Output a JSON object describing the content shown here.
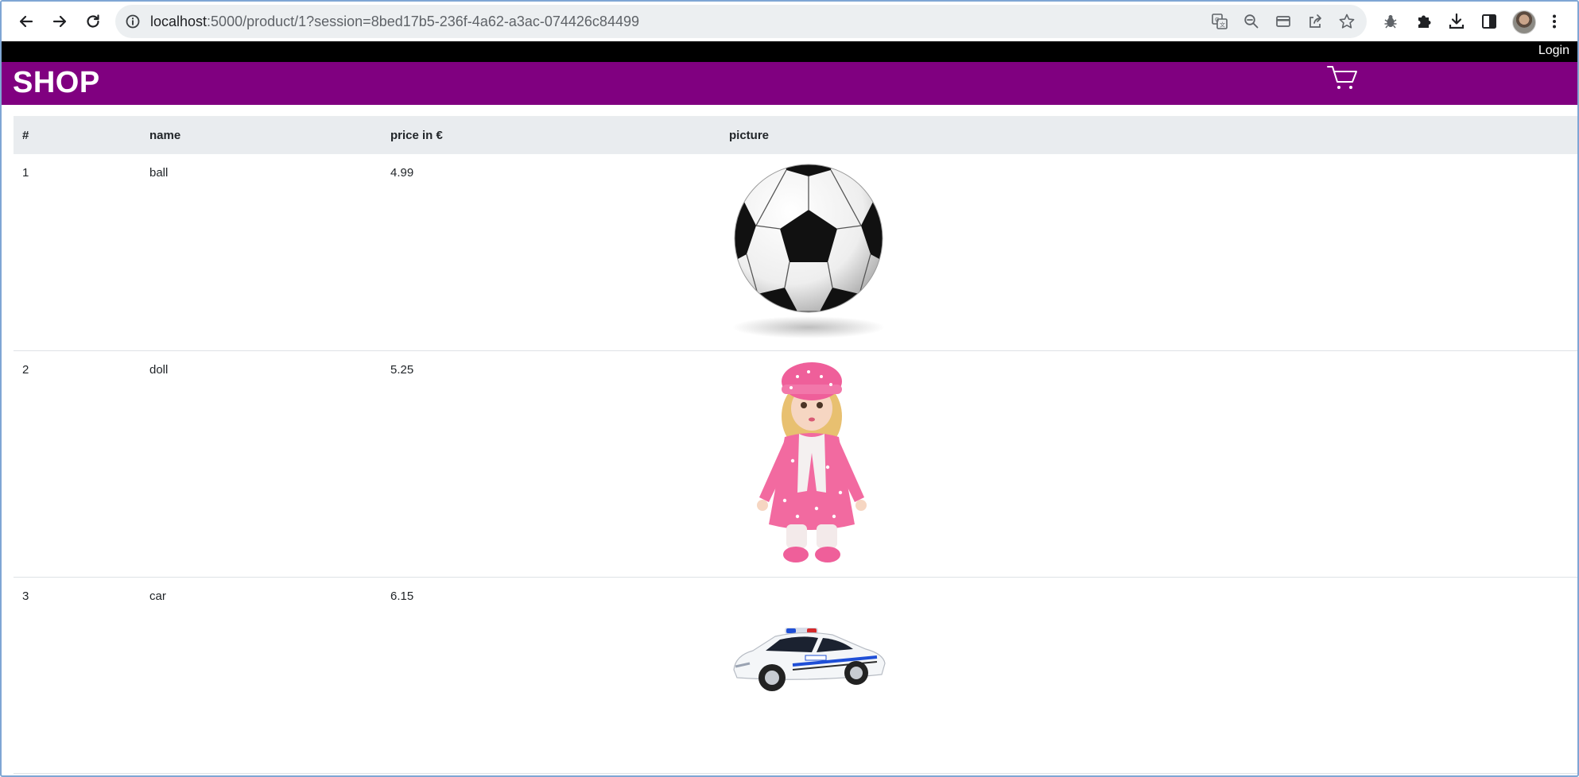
{
  "browser": {
    "url_host": "localhost",
    "url_rest": ":5000/product/1?session=8bed17b5-236f-4a62-a3ac-074426c84499",
    "toolbar_icons": [
      "back-icon",
      "forward-icon",
      "reload-icon",
      "info-icon",
      "translate-icon",
      "zoom-out-icon",
      "card-icon",
      "share-icon",
      "star-icon",
      "bug-icon",
      "extensions-icon",
      "download-icon",
      "sidepanel-icon",
      "avatar",
      "menu-icon"
    ]
  },
  "page": {
    "login_label": "Login",
    "shop_title": "SHOP",
    "header_color": "#800080",
    "cart_icon": "cart-icon"
  },
  "table": {
    "headers": [
      "#",
      "name",
      "price in €",
      "picture"
    ],
    "rows": [
      {
        "num": "1",
        "name": "ball",
        "price": "4.99",
        "picture": "soccer-ball-image"
      },
      {
        "num": "2",
        "name": "doll",
        "price": "5.25",
        "picture": "doll-image"
      },
      {
        "num": "3",
        "name": "car",
        "price": "6.15",
        "picture": "police-car-image"
      }
    ]
  }
}
